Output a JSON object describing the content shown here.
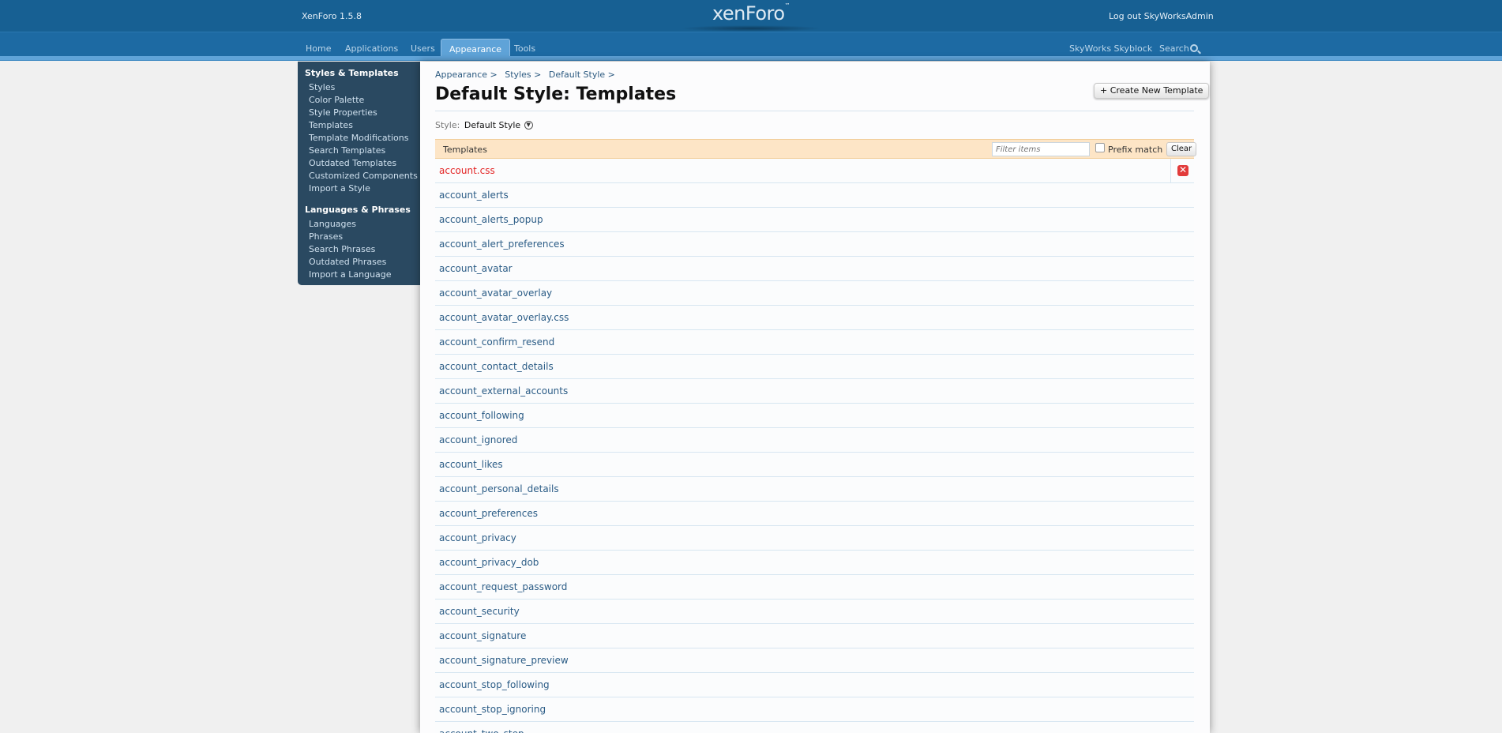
{
  "header": {
    "version": "XenForo 1.5.8",
    "logo_text": "xenForo",
    "logo_tm": "™",
    "logout": "Log out SkyWorksAdmin"
  },
  "nav": {
    "tabs": [
      "Home",
      "Applications",
      "Users",
      "Appearance",
      "Tools"
    ],
    "active_tab": "Appearance",
    "board_link": "SkyWorks Skyblock",
    "search_label": "Search"
  },
  "sidebar": {
    "sections": [
      {
        "title": "Styles & Templates",
        "items": [
          "Styles",
          "Color Palette",
          "Style Properties",
          "Templates",
          "Template Modifications",
          "Search Templates",
          "Outdated Templates",
          "Customized Components",
          "Import a Style"
        ]
      },
      {
        "title": "Languages & Phrases",
        "items": [
          "Languages",
          "Phrases",
          "Search Phrases",
          "Outdated Phrases",
          "Import a Language"
        ]
      }
    ]
  },
  "main": {
    "breadcrumb": [
      "Appearance >",
      "Styles >",
      "Default Style >"
    ],
    "title": "Default Style: Templates",
    "create_button": "+ Create New Template",
    "style_label": "Style:",
    "style_value": "Default Style",
    "list_title": "Templates",
    "filter_placeholder": "Filter items",
    "prefix_match_label": "Prefix match",
    "prefix_match_checked": false,
    "clear_button": "Clear",
    "templates": [
      {
        "name": "account.css",
        "customized": true
      },
      {
        "name": "account_alerts",
        "customized": false
      },
      {
        "name": "account_alerts_popup",
        "customized": false
      },
      {
        "name": "account_alert_preferences",
        "customized": false
      },
      {
        "name": "account_avatar",
        "customized": false
      },
      {
        "name": "account_avatar_overlay",
        "customized": false
      },
      {
        "name": "account_avatar_overlay.css",
        "customized": false
      },
      {
        "name": "account_confirm_resend",
        "customized": false
      },
      {
        "name": "account_contact_details",
        "customized": false
      },
      {
        "name": "account_external_accounts",
        "customized": false
      },
      {
        "name": "account_following",
        "customized": false
      },
      {
        "name": "account_ignored",
        "customized": false
      },
      {
        "name": "account_likes",
        "customized": false
      },
      {
        "name": "account_personal_details",
        "customized": false
      },
      {
        "name": "account_preferences",
        "customized": false
      },
      {
        "name": "account_privacy",
        "customized": false
      },
      {
        "name": "account_privacy_dob",
        "customized": false
      },
      {
        "name": "account_request_password",
        "customized": false
      },
      {
        "name": "account_security",
        "customized": false
      },
      {
        "name": "account_signature",
        "customized": false
      },
      {
        "name": "account_signature_preview",
        "customized": false
      },
      {
        "name": "account_stop_following",
        "customized": false
      },
      {
        "name": "account_stop_ignoring",
        "customized": false
      },
      {
        "name": "account_two_step",
        "customized": false
      }
    ],
    "delete_icon": "delete-x-icon"
  },
  "colors": {
    "header_bg": "#176093",
    "nav_active": "#5fa3d8",
    "sidebar_bg": "#2a4961",
    "list_header_bg": "#fde5c6",
    "customized_text": "#e32424",
    "link_text": "#2b5c86"
  }
}
